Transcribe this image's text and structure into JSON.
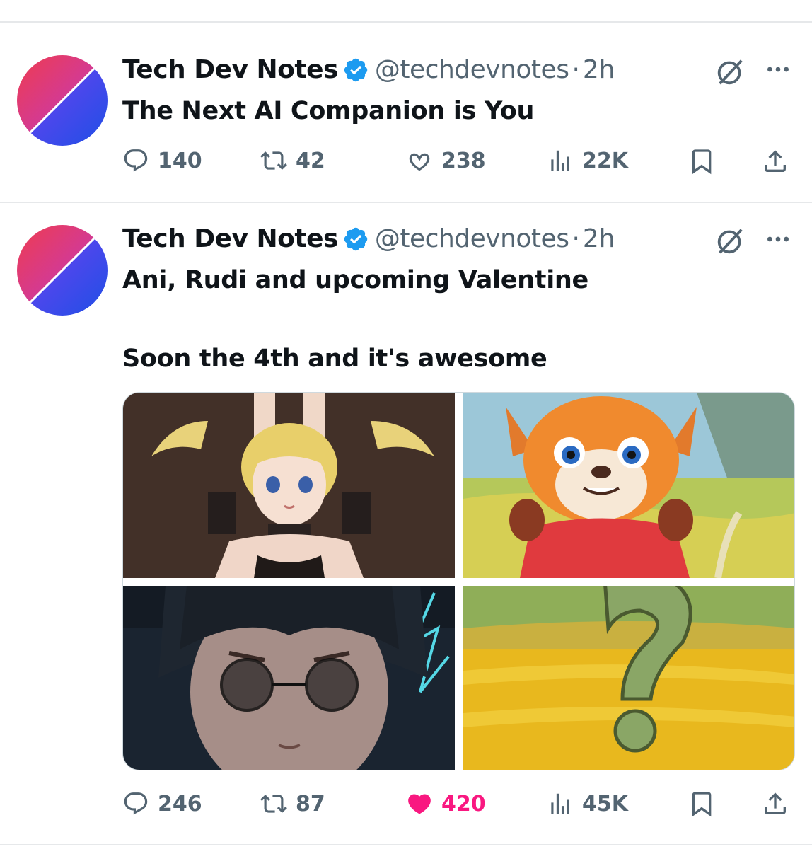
{
  "tweets": [
    {
      "author": "Tech Dev Notes",
      "handle": "@techdevnotes",
      "separator": "·",
      "time": "2h",
      "lines": [
        "The Next AI Companion is You"
      ],
      "actions": {
        "replies": "140",
        "reposts": "42",
        "likes": "238",
        "views": "22K",
        "liked": false
      }
    },
    {
      "author": "Tech Dev Notes",
      "handle": "@techdevnotes",
      "separator": "·",
      "time": "2h",
      "lines": [
        "Ani, Rudi and upcoming Valentine",
        "Soon the 4th and it's awesome"
      ],
      "media": [
        {
          "name": "media-ani",
          "alt": "anime companion with blonde twin tails"
        },
        {
          "name": "media-rudi",
          "alt": "red panda in red hoodie"
        },
        {
          "name": "media-valentine",
          "alt": "dark haired character with round glasses"
        },
        {
          "name": "media-question",
          "alt": "question mark over yellow flower field"
        }
      ],
      "actions": {
        "replies": "246",
        "reposts": "87",
        "likes": "420",
        "views": "45K",
        "liked": true
      }
    }
  ],
  "icons": {
    "verified": "verified-badge-icon",
    "grok": "grok-icon",
    "more": "more-icon",
    "reply": "reply-icon",
    "repost": "repost-icon",
    "like": "heart-icon",
    "views": "views-icon",
    "bookmark": "bookmark-icon",
    "share": "share-icon"
  },
  "colors": {
    "accent": "#1d9bf0",
    "like": "#f91880",
    "muted": "#536471"
  }
}
